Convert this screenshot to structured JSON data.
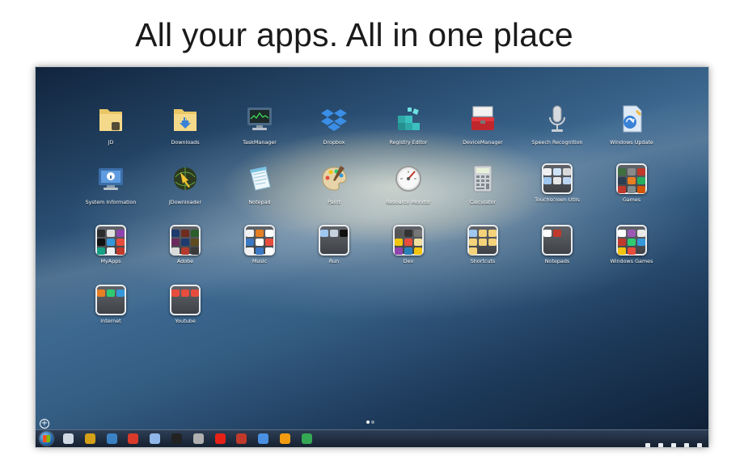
{
  "headline": "All your apps. All in one place",
  "apps": [
    {
      "label": "JD",
      "type": "folder-yellow",
      "row": 0,
      "col": 0
    },
    {
      "label": "Downloads",
      "type": "folder-download",
      "row": 0,
      "col": 1
    },
    {
      "label": "TaskManager",
      "type": "monitor",
      "row": 0,
      "col": 2
    },
    {
      "label": "Dropbox",
      "type": "dropbox",
      "row": 0,
      "col": 3
    },
    {
      "label": "Registry Editor",
      "type": "cubes",
      "row": 0,
      "col": 4
    },
    {
      "label": "DeviceManager",
      "type": "toolbox",
      "row": 0,
      "col": 5
    },
    {
      "label": "Speech Recognition",
      "type": "microphone",
      "row": 0,
      "col": 6
    },
    {
      "label": "Windows Update",
      "type": "update",
      "row": 0,
      "col": 7
    },
    {
      "label": "System Information",
      "type": "info-monitor",
      "row": 1,
      "col": 0
    },
    {
      "label": "JDownloader",
      "type": "globe",
      "row": 1,
      "col": 1
    },
    {
      "label": "Notepad",
      "type": "notepad",
      "row": 1,
      "col": 2
    },
    {
      "label": "Paint",
      "type": "palette",
      "row": 1,
      "col": 3
    },
    {
      "label": "Resource Monitor",
      "type": "gauge",
      "row": 1,
      "col": 4
    },
    {
      "label": "Calculator",
      "type": "calculator",
      "row": 1,
      "col": 5
    },
    {
      "label": "Touchscreen Utils",
      "type": "folder",
      "row": 1,
      "col": 6,
      "minis": [
        "#f0f0f0",
        "#cfe3f7",
        "#d9d9d9",
        "#9fc7ef",
        "#e6e6e6",
        "#bcd6f2"
      ]
    },
    {
      "label": "Games",
      "type": "folder",
      "row": 1,
      "col": 7,
      "minis": [
        "#3f6f3f",
        "#8a8a8a",
        "#c0392b",
        "#2c3e50",
        "#e67e22",
        "#27ae60",
        "#c0392b",
        "#7f8c8d",
        "#d35400"
      ]
    },
    {
      "label": "MyApps",
      "type": "folder",
      "row": 2,
      "col": 0,
      "minis": [
        "#2c2c2c",
        "#e0e0e0",
        "#8e44ad",
        "#111111",
        "#3498db",
        "#e74c3c",
        "#16a085",
        "#ecf0f1",
        "#c0392b"
      ]
    },
    {
      "label": "Adobe",
      "type": "folder",
      "row": 2,
      "col": 1,
      "minis": [
        "#1e3a6e",
        "#6e2b1e",
        "#2b5f2b",
        "#6b2a5e",
        "#1e3a6e",
        "#5e4b1e",
        "#d9d9d9",
        "#b33a2c",
        "#3a3a3a"
      ]
    },
    {
      "label": "Music",
      "type": "folder",
      "row": 2,
      "col": 2,
      "minis": [
        "#f2f2f2",
        "#e67e22",
        "#ffffff",
        "#3a78c5",
        "#ffffff",
        "#e74c3c",
        "#f2f2f2",
        "#3a78c5",
        "#ffffff"
      ]
    },
    {
      "label": "Run",
      "type": "folder",
      "row": 2,
      "col": 3,
      "minis": [
        "#9fc7ef",
        "#c7d2de",
        "#111111"
      ]
    },
    {
      "label": "Dev",
      "type": "folder",
      "row": 2,
      "col": 4,
      "minis": [
        "#555555",
        "#333333",
        "#777777",
        "#f1c40f",
        "#e74c3c",
        "#f0e0a0",
        "#8e44ad",
        "#2980b9",
        "#f1c40f"
      ]
    },
    {
      "label": "Shortcuts",
      "type": "folder",
      "row": 2,
      "col": 5,
      "minis": [
        "#9fc7ef",
        "#f3d27a",
        "#f3d27a",
        "#f3d27a",
        "#f3d27a",
        "#f3d27a",
        "#f3d27a"
      ]
    },
    {
      "label": "Notepads",
      "type": "folder",
      "row": 2,
      "col": 6,
      "minis": [
        "#ffffff",
        "#c0392b"
      ]
    },
    {
      "label": "Windows Games",
      "type": "folder",
      "row": 2,
      "col": 7,
      "minis": [
        "#ffffff",
        "#9b59b6",
        "#e8e8e8",
        "#c0392b",
        "#2ecc71",
        "#3498db",
        "#f1c40f",
        "#e74c3c"
      ]
    },
    {
      "label": "Internet",
      "type": "folder",
      "row": 3,
      "col": 0,
      "minis": [
        "#e67e22",
        "#2ecc71",
        "#3498db"
      ]
    },
    {
      "label": "Youtube",
      "type": "folder",
      "row": 3,
      "col": 1,
      "minis": [
        "#e74c3c",
        "#e74c3c",
        "#e74c3c"
      ]
    }
  ],
  "page_indicator": {
    "pages": 2,
    "current": 0
  },
  "taskbar": {
    "pinned": [
      {
        "name": "photos-icon",
        "color": "#cfd8e3"
      },
      {
        "name": "jdownloader-icon",
        "color": "#d4a017"
      },
      {
        "name": "windows-flag-icon",
        "color": "#3b82c4"
      },
      {
        "name": "red-diamond-icon",
        "color": "#d93a2b"
      },
      {
        "name": "launcher-icon",
        "color": "#8fb8e8"
      },
      {
        "name": "terminal-icon",
        "color": "#222222"
      },
      {
        "name": "person-icon",
        "color": "#b0b0b0"
      },
      {
        "name": "youtube-icon",
        "color": "#e62117"
      },
      {
        "name": "record-icon",
        "color": "#c0392b"
      },
      {
        "name": "arrow-icon",
        "color": "#4a90e2"
      },
      {
        "name": "vlc-icon",
        "color": "#f39c12"
      },
      {
        "name": "chrome-icon",
        "color": "#34a853"
      }
    ]
  }
}
